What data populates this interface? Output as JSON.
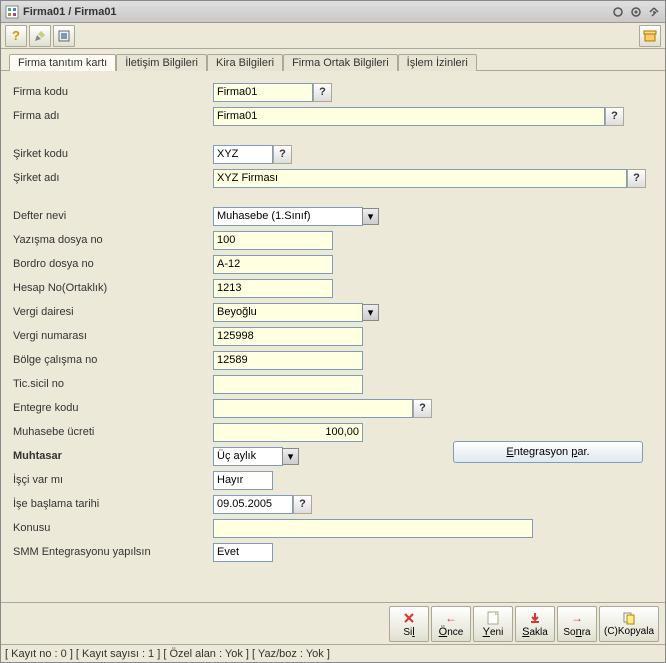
{
  "window": {
    "title": "Firma01 / Firma01"
  },
  "tabs": [
    "Firma tanıtım kartı",
    "İletişim Bilgileri",
    "Kira Bilgileri",
    "Firma Ortak Bilgileri",
    "İşlem İzinleri"
  ],
  "labels": {
    "firma_kodu": "Firma kodu",
    "firma_adi": "Firma adı",
    "sirket_kodu": "Şirket kodu",
    "sirket_adi": "Şirket adı",
    "defter_nevi": "Defter nevi",
    "yazisma_dosya": "Yazışma dosya no",
    "bordro_dosya": "Bordro dosya no",
    "hesap_no": "Hesap No(Ortaklık)",
    "vergi_dairesi": "Vergi dairesi",
    "vergi_numarasi": "Vergi numarası",
    "bolge_calisma": "Bölge çalışma no",
    "tic_sicil": "Tic.sicil no",
    "entegre_kodu": "Entegre kodu",
    "muhasebe_ucreti": "Muhasebe ücreti",
    "muhtasar": "Muhtasar",
    "isci_var": "İşçi var mı",
    "ise_baslama": "İşe başlama tarihi",
    "konusu": "Konusu",
    "smm_ent": "SMM Entegrasyonu yapılsın"
  },
  "values": {
    "firma_kodu": "Firma01",
    "firma_adi": "Firma01",
    "sirket_kodu": "XYZ",
    "sirket_adi": "XYZ Firması",
    "defter_nevi": "Muhasebe (1.Sınıf)",
    "yazisma_dosya": "100",
    "bordro_dosya": "A-12",
    "hesap_no": "1213",
    "vergi_dairesi": "Beyoğlu",
    "vergi_numarasi": "125998",
    "bolge_calisma": "12589",
    "tic_sicil": "",
    "entegre_kodu": "",
    "muhasebe_ucreti": "100,00",
    "muhtasar": "Üç aylık",
    "isci_var": "Hayır",
    "ise_baslama": "09.05.2005",
    "konusu": "",
    "smm_ent": "Evet"
  },
  "buttons": {
    "entegrasyon": "Entegrasyon par.",
    "sil": "Sil",
    "once": "Önce",
    "yeni": "Yeni",
    "sakla": "Sakla",
    "sonra": "Sonra",
    "kopyala": "(C)Kopyala"
  },
  "status": "[ Kayıt no : 0 ] [ Kayıt sayısı : 1 ] [ Özel alan : Yok ] [ Yaz/boz : Yok ]"
}
